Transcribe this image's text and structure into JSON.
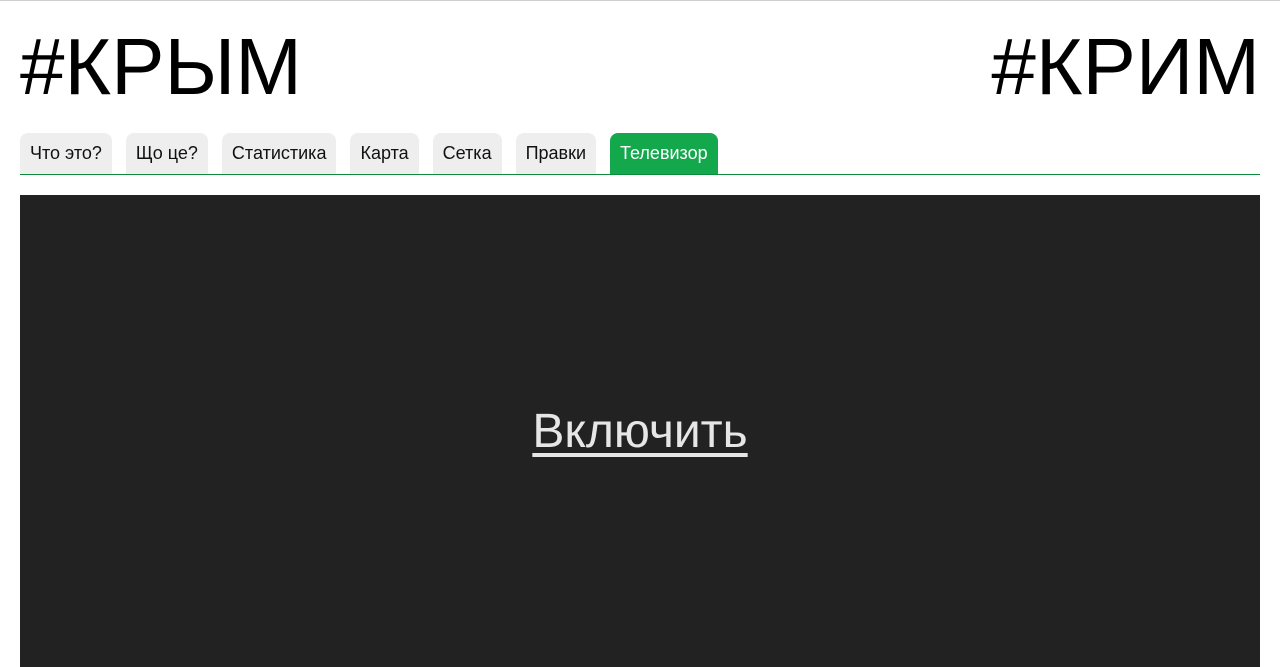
{
  "header": {
    "title_left": "#КРЫМ",
    "title_right": "#КРИМ"
  },
  "tabs": [
    {
      "label": "Что это?",
      "active": false
    },
    {
      "label": "Що це?",
      "active": false
    },
    {
      "label": "Статистика",
      "active": false
    },
    {
      "label": "Карта",
      "active": false
    },
    {
      "label": "Сетка",
      "active": false
    },
    {
      "label": "Правки",
      "active": false
    },
    {
      "label": "Телевизор",
      "active": true
    }
  ],
  "tv": {
    "enable_label": "Включить"
  },
  "colors": {
    "active_tab_bg": "#13a84b",
    "tab_bg": "#eeeeee",
    "tabs_underline": "#0a8a3a",
    "tv_bg": "#222222",
    "tv_link": "#e6e6e6"
  }
}
